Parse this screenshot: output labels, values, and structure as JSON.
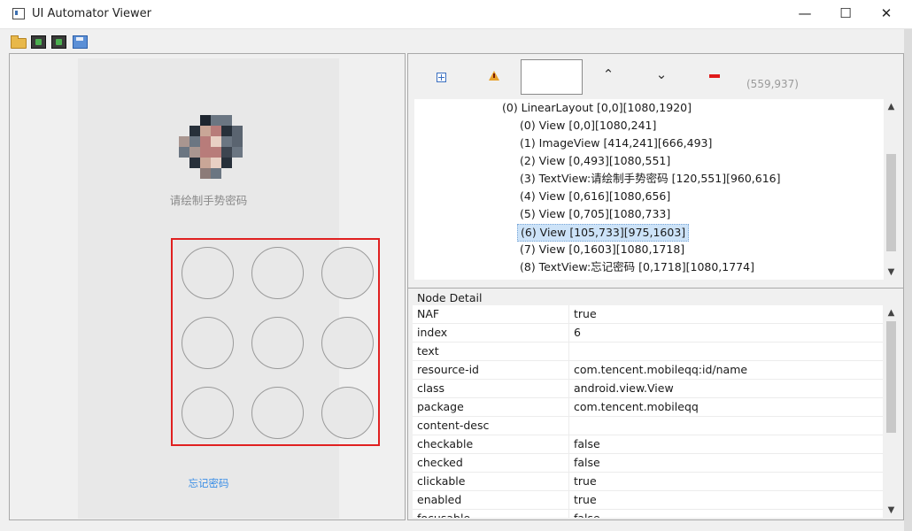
{
  "window": {
    "title": "UI Automator Viewer",
    "min": "—",
    "max": "☐",
    "close": "✕"
  },
  "toolbar": {
    "icons": [
      "folder-open-icon",
      "device-screenshot-icon",
      "device-screenshot-compressed-icon",
      "save-icon"
    ]
  },
  "phone": {
    "prompt": "请绘制手势密码",
    "forgot": "忘记密码",
    "gesture_grid": {
      "rows": 3,
      "cols": 3
    },
    "highlight_color": "#e02020",
    "link_color": "#3a8ee6"
  },
  "tree_toolbar": {
    "coords": "(559,937)",
    "up": "⌃",
    "down": "⌄"
  },
  "tree": {
    "nodes": [
      "(0) LinearLayout [0,0][1080,1920]",
      "(0) View [0,0][1080,241]",
      "(1) ImageView [414,241][666,493]",
      "(2) View [0,493][1080,551]",
      "(3) TextView:请绘制手势密码 [120,551][960,616]",
      "(4) View [0,616][1080,656]",
      "(5) View [0,705][1080,733]",
      "(6) View [105,733][975,1603]",
      "(7) View [0,1603][1080,1718]",
      "(8) TextView:忘记密码 [0,1718][1080,1774]"
    ],
    "selected_index": 7
  },
  "detail": {
    "label": "Node Detail",
    "rows": [
      {
        "key": "NAF",
        "value": "true"
      },
      {
        "key": "index",
        "value": "6"
      },
      {
        "key": "text",
        "value": ""
      },
      {
        "key": "resource-id",
        "value": "com.tencent.mobileqq:id/name"
      },
      {
        "key": "class",
        "value": "android.view.View"
      },
      {
        "key": "package",
        "value": "com.tencent.mobileqq"
      },
      {
        "key": "content-desc",
        "value": ""
      },
      {
        "key": "checkable",
        "value": "false"
      },
      {
        "key": "checked",
        "value": "false"
      },
      {
        "key": "clickable",
        "value": "true"
      },
      {
        "key": "enabled",
        "value": "true"
      },
      {
        "key": "focusable",
        "value": "false"
      }
    ]
  },
  "scroll": {
    "up": "▲",
    "down": "▼"
  }
}
